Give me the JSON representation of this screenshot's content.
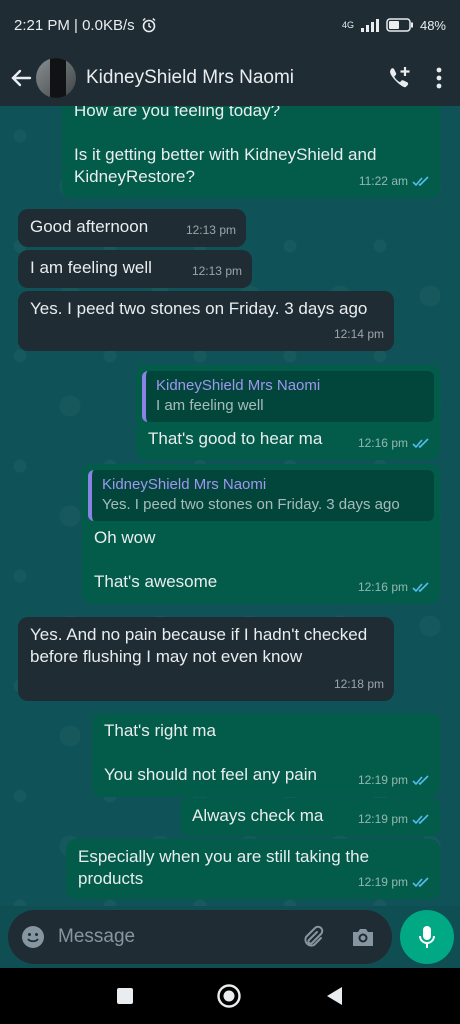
{
  "status_bar": {
    "time_speed": "2:21 PM | 0.0KB/s",
    "network": "4G",
    "battery": "48%"
  },
  "header": {
    "contact_name": "KidneyShield Mrs Naomi"
  },
  "messages": [
    {
      "direction": "out",
      "text": "How are you feeling today?\n\nIs it getting better with KidneyShield and KidneyRestore?",
      "time": "11:22 am",
      "read": true
    },
    {
      "direction": "in",
      "text": "Good afternoon",
      "time": "12:13 pm"
    },
    {
      "direction": "in",
      "text": "I am feeling well",
      "time": "12:13 pm"
    },
    {
      "direction": "in",
      "text": "Yes. I peed two stones on Friday. 3 days ago",
      "time": "12:14 pm"
    },
    {
      "direction": "out",
      "quote_name": "KidneyShield Mrs Naomi",
      "quote_text": "I am feeling well",
      "text": "That's good to hear ma",
      "time": "12:16 pm",
      "read": true
    },
    {
      "direction": "out",
      "quote_name": "KidneyShield Mrs Naomi",
      "quote_text": "Yes. I peed two stones on Friday. 3 days ago",
      "text": "Oh wow\n\nThat's awesome",
      "time": "12:16 pm",
      "read": true
    },
    {
      "direction": "in",
      "text": "Yes. And no pain because if I hadn't checked before flushing I may not even know",
      "time": "12:18 pm"
    },
    {
      "direction": "out",
      "text": "That's right ma\n\nYou should not feel any pain",
      "time": "12:19 pm",
      "read": true
    },
    {
      "direction": "out",
      "text": "Always check ma",
      "time": "12:19 pm",
      "read": true
    },
    {
      "direction": "out",
      "text": "Especially when you are still taking the products",
      "time": "12:19 pm",
      "read": true
    }
  ],
  "composer": {
    "placeholder": "Message"
  },
  "colors": {
    "incoming_bubble": "#1f2c34",
    "outgoing_bubble": "#035c4a",
    "read_ticks": "#53bdeb",
    "quote_accent": "#8b82e6",
    "mic_button": "#00a884"
  }
}
